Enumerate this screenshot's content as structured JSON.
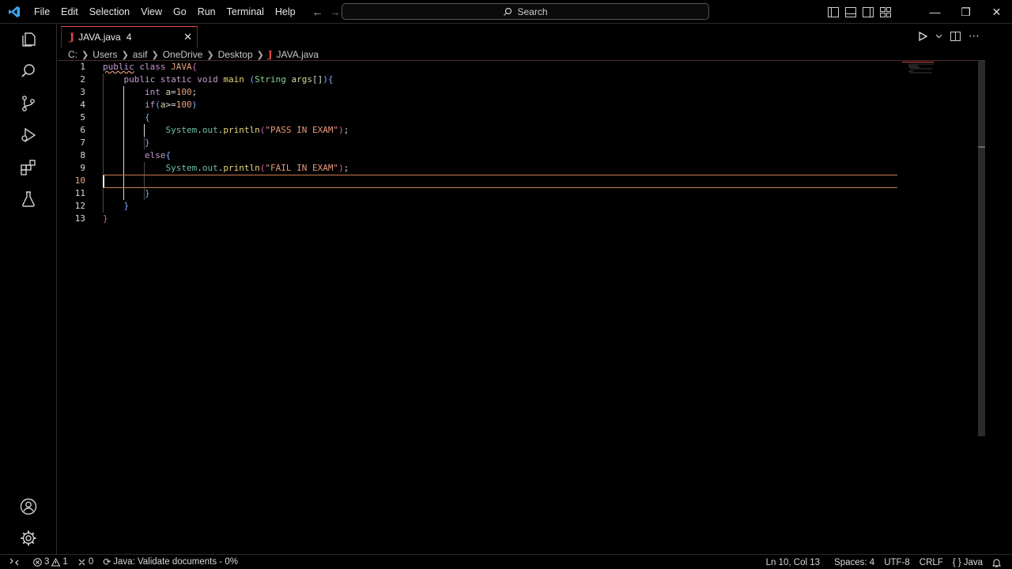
{
  "titlebar": {
    "menu": [
      "File",
      "Edit",
      "Selection",
      "View",
      "Go",
      "Run",
      "Terminal",
      "Help"
    ],
    "search_placeholder": "Search"
  },
  "tab": {
    "filename": "JAVA.java",
    "problem_count": "4",
    "file_icon": "J"
  },
  "breadcrumb": [
    "C:",
    "Users",
    "asif",
    "OneDrive",
    "Desktop",
    "JAVA.java"
  ],
  "editor": {
    "line_numbers": [
      "1",
      "2",
      "3",
      "4",
      "5",
      "6",
      "7",
      "8",
      "9",
      "10",
      "11",
      "12",
      "13"
    ],
    "active_line": "10",
    "code": {
      "l1": [
        "public",
        "class",
        "JAVA",
        "{"
      ],
      "l2": [
        "public",
        "static",
        "void",
        "main",
        "(",
        "String",
        "args",
        "[]",
        ")",
        "{"
      ],
      "l3": [
        "int",
        "a",
        "=",
        "100",
        ";"
      ],
      "l4": [
        "if",
        "(",
        "a",
        ">=",
        "100",
        ")"
      ],
      "l5": [
        "{"
      ],
      "l6": [
        "System",
        ".",
        "out",
        ".",
        "println",
        "(",
        "\"PASS IN EXAM\"",
        ")",
        ";"
      ],
      "l7": [
        "}"
      ],
      "l8": [
        "else",
        "{"
      ],
      "l9": [
        "System",
        ".",
        "out",
        ".",
        "println",
        "(",
        "\"FAIL IN EXAM\"",
        ")",
        ";"
      ],
      "l11": [
        "}"
      ],
      "l12": [
        "}"
      ],
      "l13": [
        "}"
      ]
    }
  },
  "statusbar": {
    "errors": "3",
    "warnings": "1",
    "ports": "0",
    "task": "Java: Validate documents - 0%",
    "position": "Ln 10, Col 13",
    "spaces": "Spaces: 4",
    "encoding": "UTF-8",
    "eol": "CRLF",
    "language": "Java"
  },
  "colors": {
    "accent": "#e04848",
    "background": "#000000",
    "current_line_border": "#c87a50"
  }
}
